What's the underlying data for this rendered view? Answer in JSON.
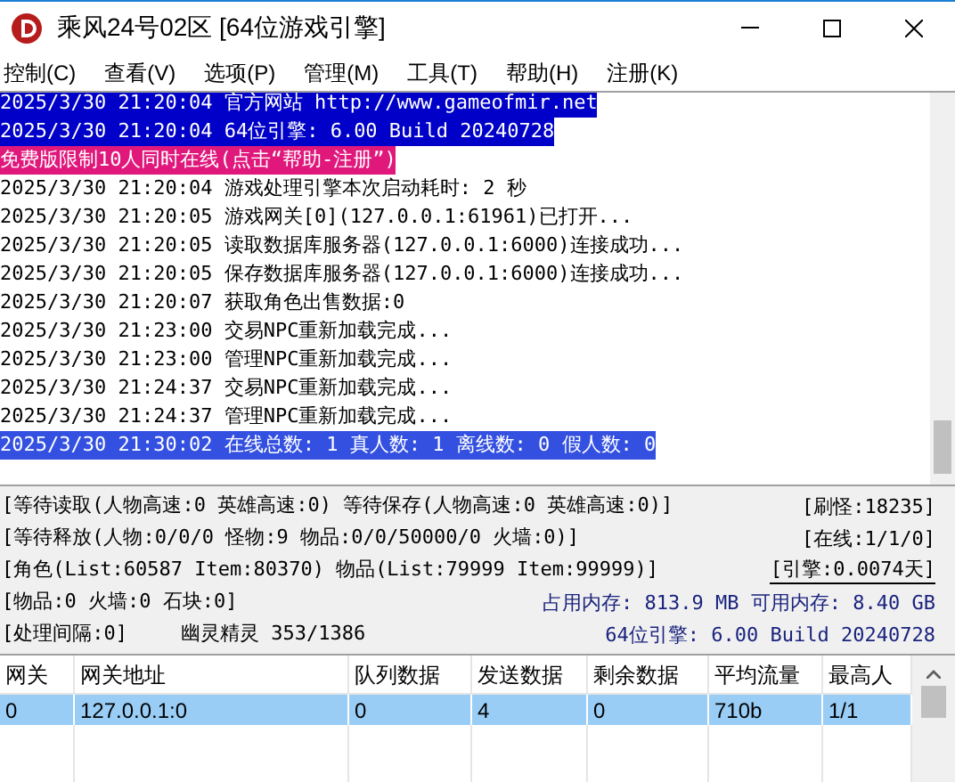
{
  "window": {
    "title": "乘风24号02区 [64位游戏引擎]"
  },
  "menu": [
    "控制(C)",
    "查看(V)",
    "选项(P)",
    "管理(M)",
    "工具(T)",
    "帮助(H)",
    "注册(K)"
  ],
  "log": [
    {
      "kind": "highlight",
      "text": "2025/3/30 21:20:04 官方网站 http://www.gameofmir.net"
    },
    {
      "kind": "highlight",
      "text": "2025/3/30 21:20:04 64位引擎: 6.00 Build 20240728"
    },
    {
      "kind": "notice",
      "text": "免费版限制10人同时在线(点击“帮助-注册”)"
    },
    {
      "kind": "normal",
      "text": "2025/3/30 21:20:04 游戏处理引擎本次启动耗时: 2 秒"
    },
    {
      "kind": "normal",
      "text": "2025/3/30 21:20:05 游戏网关[0](127.0.0.1:61961)已打开..."
    },
    {
      "kind": "normal",
      "text": "2025/3/30 21:20:05 读取数据库服务器(127.0.0.1:6000)连接成功..."
    },
    {
      "kind": "normal",
      "text": "2025/3/30 21:20:05 保存数据库服务器(127.0.0.1:6000)连接成功..."
    },
    {
      "kind": "normal",
      "text": "2025/3/30 21:20:07 获取角色出售数据:0"
    },
    {
      "kind": "normal",
      "text": "2025/3/30 21:23:00 交易NPC重新加载完成..."
    },
    {
      "kind": "normal",
      "text": "2025/3/30 21:23:00 管理NPC重新加载完成..."
    },
    {
      "kind": "normal",
      "text": "2025/3/30 21:24:37 交易NPC重新加载完成..."
    },
    {
      "kind": "normal",
      "text": "2025/3/30 21:24:37 管理NPC重新加载完成..."
    },
    {
      "kind": "summary",
      "text": "2025/3/30 21:30:02 在线总数: 1 真人数: 1 离线数: 0 假人数: 0"
    }
  ],
  "status": [
    {
      "left": [
        "[等待读取(人物高速:0 英雄高速:0) 等待保存(人物高速:0 英雄高速:0)]"
      ],
      "right": "[刷怪:18235]",
      "kind": "plain"
    },
    {
      "left": [
        "[等待释放(人物:0/0/0 怪物:9 物品:0/0/50000/0 火墙:0)]"
      ],
      "right": "[在线:1/1/0]",
      "kind": "plain"
    },
    {
      "left": [
        "[角色(List:60587 Item:80370) 物品(List:79999 Item:99999)]"
      ],
      "right": "[引擎:0.0074天]",
      "kind": "boxed"
    },
    {
      "left": [
        "[物品:0 火墙:0 石块:0]"
      ],
      "right": "占用内存: 813.9 MB 可用内存: 8.40 GB",
      "kind": "info"
    },
    {
      "left": [
        "[处理间隔:0]",
        "幽灵精灵 353/1386"
      ],
      "right": "64位引擎: 6.00 Build 20240728",
      "kind": "info"
    }
  ],
  "table": {
    "columns": [
      "网关",
      "网关地址",
      "队列数据",
      "发送数据",
      "剩余数据",
      "平均流量",
      "最高人"
    ],
    "rows": [
      {
        "selected": true,
        "cells": [
          "0",
          "127.0.0.1:0",
          "0",
          "4",
          "0",
          "710b",
          "1/1"
        ]
      }
    ]
  }
}
